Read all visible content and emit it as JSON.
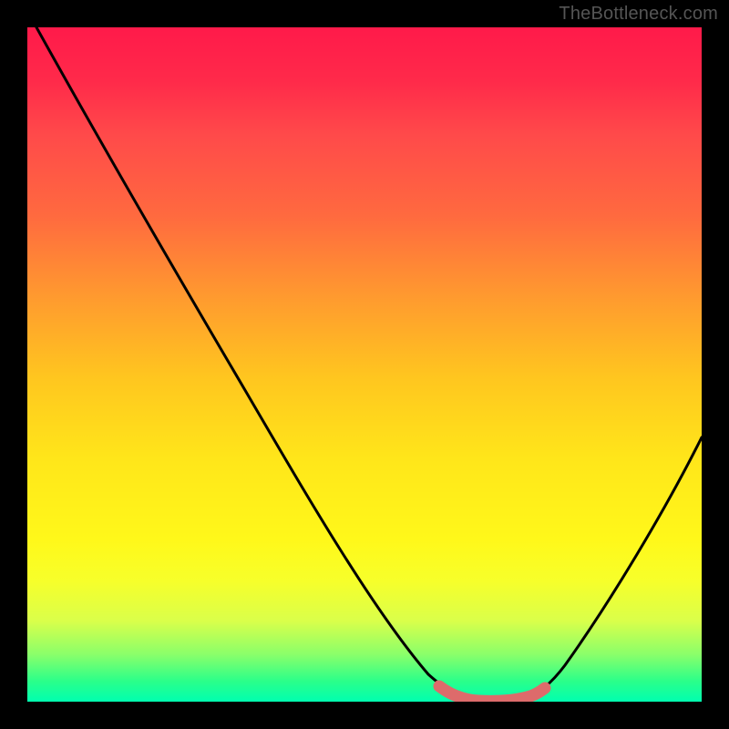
{
  "watermark": "TheBottleneck.com",
  "chart_data": {
    "type": "line",
    "title": "",
    "xlabel": "",
    "ylabel": "",
    "xlim": [
      0,
      100
    ],
    "ylim": [
      0,
      100
    ],
    "grid": false,
    "series": [
      {
        "name": "bottleneck-curve",
        "x": [
          0,
          5,
          10,
          15,
          20,
          25,
          30,
          35,
          40,
          45,
          50,
          55,
          60,
          62,
          65,
          68,
          72,
          75,
          78,
          80,
          85,
          90,
          95,
          100
        ],
        "y": [
          100,
          93,
          85,
          77,
          69,
          61,
          53,
          45,
          37,
          29,
          21,
          13,
          6,
          3,
          1,
          0,
          0,
          1,
          3,
          6,
          13,
          21,
          30,
          40
        ],
        "color": "#000000"
      },
      {
        "name": "optimal-zone-marker",
        "x": [
          62,
          64,
          66,
          68,
          70,
          72,
          74,
          76
        ],
        "y": [
          1,
          0.5,
          0.3,
          0.2,
          0.2,
          0.4,
          0.8,
          1.5
        ],
        "color": "#e06666"
      }
    ],
    "gradient_stops": [
      {
        "pos": 0,
        "color": "#ff1a4a"
      },
      {
        "pos": 50,
        "color": "#ffe61a"
      },
      {
        "pos": 100,
        "color": "#00ffb0"
      }
    ]
  }
}
